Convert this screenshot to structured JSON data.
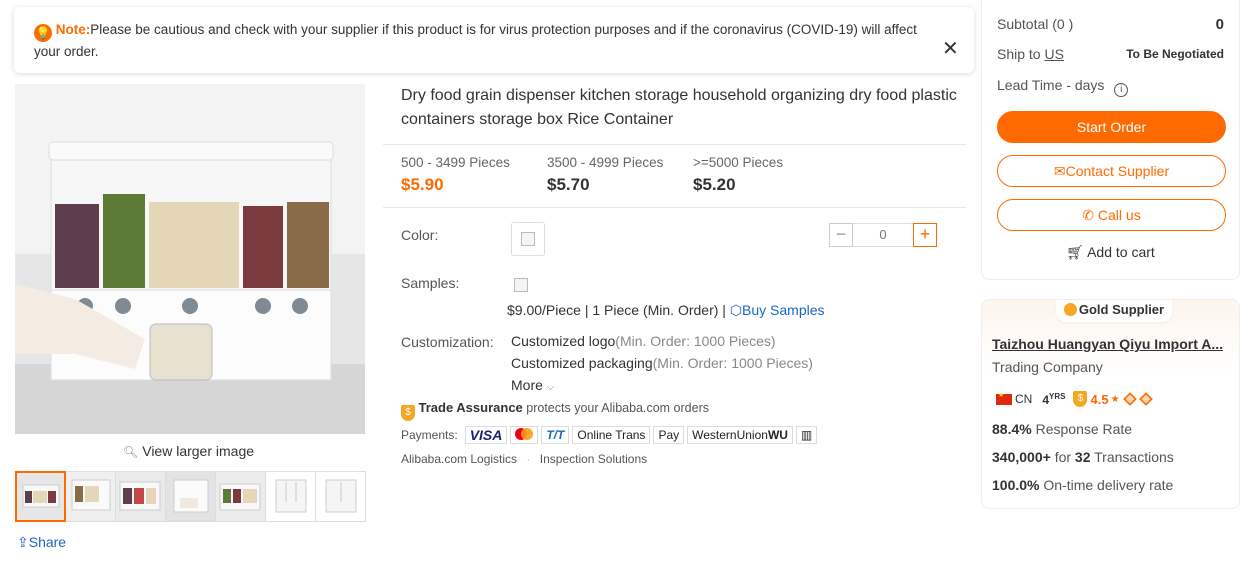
{
  "note": {
    "label": "Note:",
    "text": "Please be cautious and check with your supplier if this product is for virus protection purposes and if the coronavirus (COVID-19) will affect your order."
  },
  "gallery": {
    "view_larger": "View larger image",
    "share": "Share",
    "thumb_count": 7
  },
  "product": {
    "title": "Dry food grain dispenser kitchen storage household organizing dry food plastic containers storage box Rice Container",
    "tiers": [
      {
        "qty": "500 - 3499 Pieces",
        "price": "$5.90"
      },
      {
        "qty": "3500 - 4999 Pieces",
        "price": "$5.70"
      },
      {
        "qty": ">=5000 Pieces",
        "price": "$5.20"
      }
    ],
    "color_label": "Color:",
    "quantity": "0",
    "samples_label": "Samples:",
    "sample_text": "$9.00/Piece | 1 Piece (Min. Order) |",
    "buy_samples": "Buy Samples",
    "customization_label": "Customization:",
    "customizations": [
      {
        "name": "Customized logo",
        "min": "(Min. Order: 1000 Pieces)"
      },
      {
        "name": "Customized packaging",
        "min": "(Min. Order: 1000 Pieces)"
      }
    ],
    "more": "More",
    "trade_assurance": "Trade Assurance",
    "trade_text": "protects your Alibaba.com orders",
    "payments_label": "Payments:",
    "payments": [
      "VISA",
      "T/T",
      "Online Trans",
      "Pay",
      "WesternUnion",
      "WU"
    ],
    "logistics": "Alibaba.com Logistics",
    "inspection": "Inspection Solutions"
  },
  "order": {
    "subtotal_label": "Subtotal (0 )",
    "subtotal_value": "0",
    "ship_to_label": "Ship to",
    "ship_to_country": "US",
    "ship_value": "To Be Negotiated",
    "lead_time": "Lead Time - days",
    "start_order": "Start Order",
    "contact_supplier": "Contact Supplier",
    "call_us": "Call us",
    "add_to_cart": "Add to cart"
  },
  "supplier": {
    "badge": "Gold Supplier",
    "company": "Taizhou Huangyan Qiyu Import A...",
    "type": "Trading Company",
    "country": "CN",
    "years": "4",
    "years_unit": "YRS",
    "rating": "4.5",
    "response_rate": "88.4%",
    "response_label": "Response Rate",
    "transactions_amount": "340,000+",
    "transactions_for": "for",
    "transactions_count": "32",
    "transactions_label": "Transactions",
    "ontime_rate": "100.0%",
    "ontime_label": "On-time delivery rate"
  },
  "colors": {
    "accent": "#ff6a00",
    "link": "#1a66c4"
  }
}
